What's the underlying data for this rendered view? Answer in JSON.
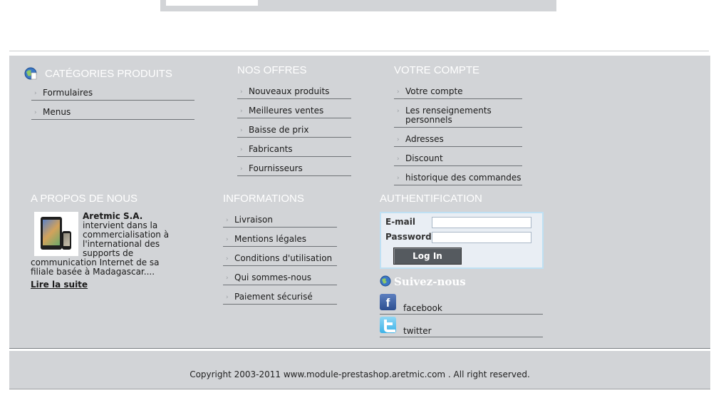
{
  "categories": {
    "title": "CATÉGORIES PRODUITS",
    "icon": "globe-icon",
    "items": [
      "Formulaires",
      "Menus"
    ]
  },
  "offers": {
    "title": "NOS OFFRES",
    "items": [
      "Nouveaux produits",
      "Meilleures ventes",
      "Baisse de prix",
      "Fabricants",
      "Fournisseurs"
    ]
  },
  "account": {
    "title": "VOTRE COMPTE",
    "items": [
      "Votre compte",
      "Les renseignements personnels",
      "Adresses",
      "Discount",
      "historique des commandes"
    ]
  },
  "about": {
    "title": "A PROPOS DE NOUS",
    "company": "Aretmic S.A.",
    "text": " intervient dans la commercialisation à l'international des supports de communication Internet de sa filiale basée à Madagascar....",
    "read_more": "Lire la suite"
  },
  "informations": {
    "title": "INFORMATIONS",
    "items": [
      "Livraison",
      "Mentions légales",
      "Conditions d'utilisation",
      "Qui sommes-nous",
      "Paiement sécurisé"
    ]
  },
  "auth": {
    "title": "AUTHENTIFICATION",
    "email_label": "E-mail",
    "password_label": "Password",
    "email_value": "",
    "password_value": "",
    "login_button": "Log In"
  },
  "follow": {
    "title": "Suivez-nous",
    "facebook": "facebook",
    "twitter": "twitter"
  },
  "footer": {
    "copyright": "Copyright 2003-2011 www.module-prestashop.aretmic.com . All right reserved."
  },
  "colors": {
    "panel": "#d2d4d7",
    "heading": "#ffffff",
    "login_box": "#e9eef4"
  }
}
